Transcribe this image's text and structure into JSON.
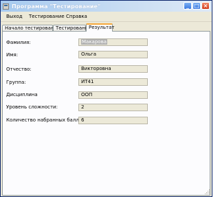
{
  "window": {
    "title": "Программа \"Тестирование\""
  },
  "window_controls": {
    "minimize": "_",
    "maximize": "□",
    "close": "×"
  },
  "menu": {
    "items": [
      "Выход",
      "Тестирование",
      "Справка"
    ]
  },
  "tabs": [
    {
      "label": "Начало тестирования",
      "active": false
    },
    {
      "label": "Тестирование",
      "active": false
    },
    {
      "label": "Результат",
      "active": true
    }
  ],
  "form": {
    "fields": [
      {
        "label": "Фамилия:",
        "value": "Макарова",
        "selected": true
      },
      {
        "label": "Имя:",
        "value": "Ольга",
        "selected": false
      },
      {
        "label": "Отчество:",
        "value": "Викторовна",
        "selected": false
      },
      {
        "label": "Группа:",
        "value": "ИТ41",
        "selected": false
      },
      {
        "label": "Дисциплина",
        "value": "ООП",
        "selected": false
      },
      {
        "label": "Уровень сложности:",
        "value": "2",
        "selected": false
      },
      {
        "label": "Количество набранных баллов",
        "value": "6",
        "selected": false
      }
    ]
  },
  "colors": {
    "active_tab_accent": "#f5a73a",
    "field_background": "#ece9d8",
    "titlebar": "#a6caf0"
  },
  "icons": {
    "app": "app-window-icon",
    "grip": "resize-grip-icon"
  }
}
